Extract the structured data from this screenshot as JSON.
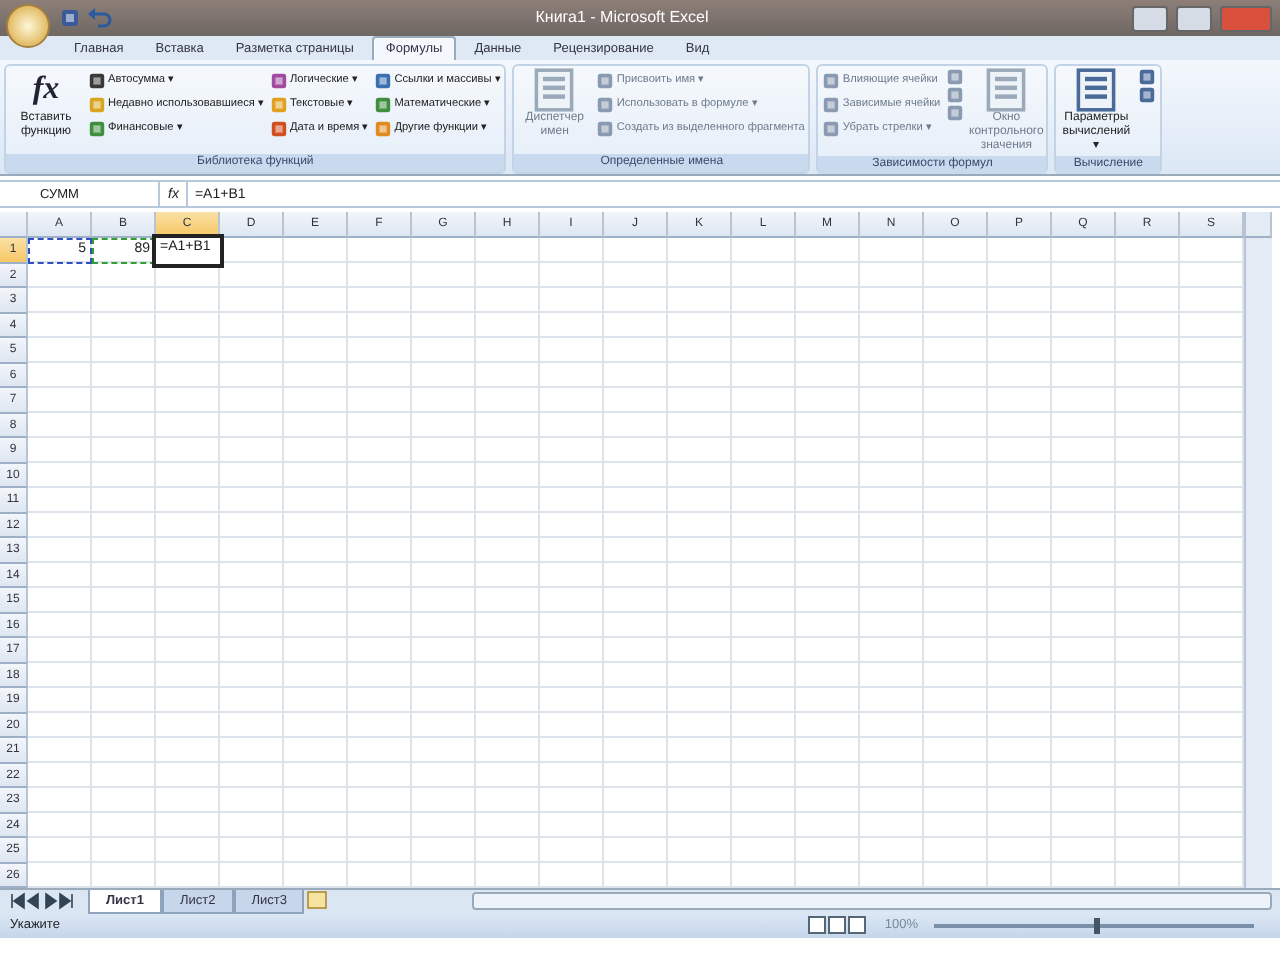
{
  "window": {
    "title": "Книга1 - Microsoft Excel"
  },
  "tabs": [
    {
      "label": "Главная",
      "selected": false
    },
    {
      "label": "Вставка",
      "selected": false
    },
    {
      "label": "Разметка страницы",
      "selected": false
    },
    {
      "label": "Формулы",
      "selected": true
    },
    {
      "label": "Данные",
      "selected": false
    },
    {
      "label": "Рецензирование",
      "selected": false
    },
    {
      "label": "Вид",
      "selected": false
    }
  ],
  "ribbon_groups": [
    {
      "label": "Библиотека функций",
      "disabled": false,
      "large": {
        "label": "Вставить функцию",
        "icon_text": "fx"
      },
      "columns": [
        [
          {
            "label": "Автосумма ▾",
            "color": "#3a3a3a"
          },
          {
            "label": "Недавно использовавшиеся ▾",
            "color": "#d9a520"
          },
          {
            "label": "Финансовые ▾",
            "color": "#3f8f3f"
          }
        ],
        [
          {
            "label": "Логические ▾",
            "color": "#a04aa0"
          },
          {
            "label": "Текстовые ▾",
            "color": "#e0a020"
          },
          {
            "label": "Дата и время ▾",
            "color": "#d05020"
          }
        ],
        [
          {
            "label": "Ссылки и массивы ▾",
            "color": "#3a70b0"
          },
          {
            "label": "Математические ▾",
            "color": "#3f8f3f"
          },
          {
            "label": "Другие функции ▾",
            "color": "#e08a20"
          }
        ]
      ]
    },
    {
      "label": "Определенные имена",
      "disabled": true,
      "large": {
        "label": "Диспетчер имен"
      },
      "columns": [
        [
          {
            "label": "Присвоить имя ▾",
            "color": "#8a9ab0"
          },
          {
            "label": "Использовать в формуле ▾",
            "color": "#8a9ab0"
          },
          {
            "label": "Создать из выделенного фрагмента",
            "color": "#8a9ab0"
          }
        ]
      ]
    },
    {
      "label": "Зависимости формул",
      "disabled": true,
      "columns": [
        [
          {
            "label": "Влияющие ячейки",
            "color": "#8a9ab0"
          },
          {
            "label": "Зависимые ячейки",
            "color": "#8a9ab0"
          },
          {
            "label": "Убрать стрелки ▾",
            "color": "#8a9ab0"
          }
        ],
        [
          {
            "color": "#8a9ab0"
          },
          {
            "color": "#8a9ab0"
          },
          {
            "color": "#8a9ab0"
          }
        ]
      ],
      "large_after": {
        "label": "Окно контрольного значения"
      }
    },
    {
      "label": "Вычисление",
      "disabled": false,
      "large": {
        "label": "Параметры вычислений ▾"
      },
      "columns": [
        [
          {
            "color": "#4a6a9a"
          },
          {
            "color": "#4a6a9a"
          }
        ]
      ]
    }
  ],
  "formula_bar": {
    "name_box": "СУММ",
    "fx": "fx",
    "formula": "=A1+B1"
  },
  "columns": [
    {
      "label": "A",
      "selected": false
    },
    {
      "label": "B",
      "selected": false
    },
    {
      "label": "C",
      "selected": true
    },
    {
      "label": "D",
      "selected": false
    },
    {
      "label": "E",
      "selected": false
    },
    {
      "label": "F",
      "selected": false
    },
    {
      "label": "G",
      "selected": false
    },
    {
      "label": "H",
      "selected": false
    },
    {
      "label": "I",
      "selected": false
    },
    {
      "label": "J",
      "selected": false
    },
    {
      "label": "K",
      "selected": false
    },
    {
      "label": "L",
      "selected": false
    },
    {
      "label": "M",
      "selected": false
    },
    {
      "label": "N",
      "selected": false
    },
    {
      "label": "O",
      "selected": false
    },
    {
      "label": "P",
      "selected": false
    },
    {
      "label": "Q",
      "selected": false
    },
    {
      "label": "R",
      "selected": false
    },
    {
      "label": "S",
      "selected": false
    }
  ],
  "rows": [
    {
      "label": "1",
      "selected": true
    },
    {
      "label": "2",
      "selected": false
    },
    {
      "label": "3",
      "selected": false
    },
    {
      "label": "4",
      "selected": false
    },
    {
      "label": "5",
      "selected": false
    },
    {
      "label": "6",
      "selected": false
    },
    {
      "label": "7",
      "selected": false
    },
    {
      "label": "8",
      "selected": false
    },
    {
      "label": "9",
      "selected": false
    },
    {
      "label": "10",
      "selected": false
    },
    {
      "label": "11",
      "selected": false
    },
    {
      "label": "12",
      "selected": false
    },
    {
      "label": "13",
      "selected": false
    },
    {
      "label": "14",
      "selected": false
    },
    {
      "label": "15",
      "selected": false
    },
    {
      "label": "16",
      "selected": false
    },
    {
      "label": "17",
      "selected": false
    },
    {
      "label": "18",
      "selected": false
    },
    {
      "label": "19",
      "selected": false
    },
    {
      "label": "20",
      "selected": false
    },
    {
      "label": "21",
      "selected": false
    },
    {
      "label": "22",
      "selected": false
    },
    {
      "label": "23",
      "selected": false
    },
    {
      "label": "24",
      "selected": false
    },
    {
      "label": "25",
      "selected": false
    },
    {
      "label": "26",
      "selected": false
    }
  ],
  "first_row_cells": [
    {
      "value": "5",
      "kind": "number",
      "color": "#3050c0"
    },
    {
      "value": "89",
      "kind": "number",
      "color": "#30a030"
    },
    {
      "value": "=A1+B1",
      "kind": "editing"
    }
  ],
  "sheet_tabs": [
    {
      "label": "Лист1",
      "selected": true
    },
    {
      "label": "Лист2",
      "selected": false
    },
    {
      "label": "Лист3",
      "selected": false
    }
  ],
  "status_bar": {
    "mode": "Укажите",
    "zoom": "100%",
    "level": 0.5
  }
}
